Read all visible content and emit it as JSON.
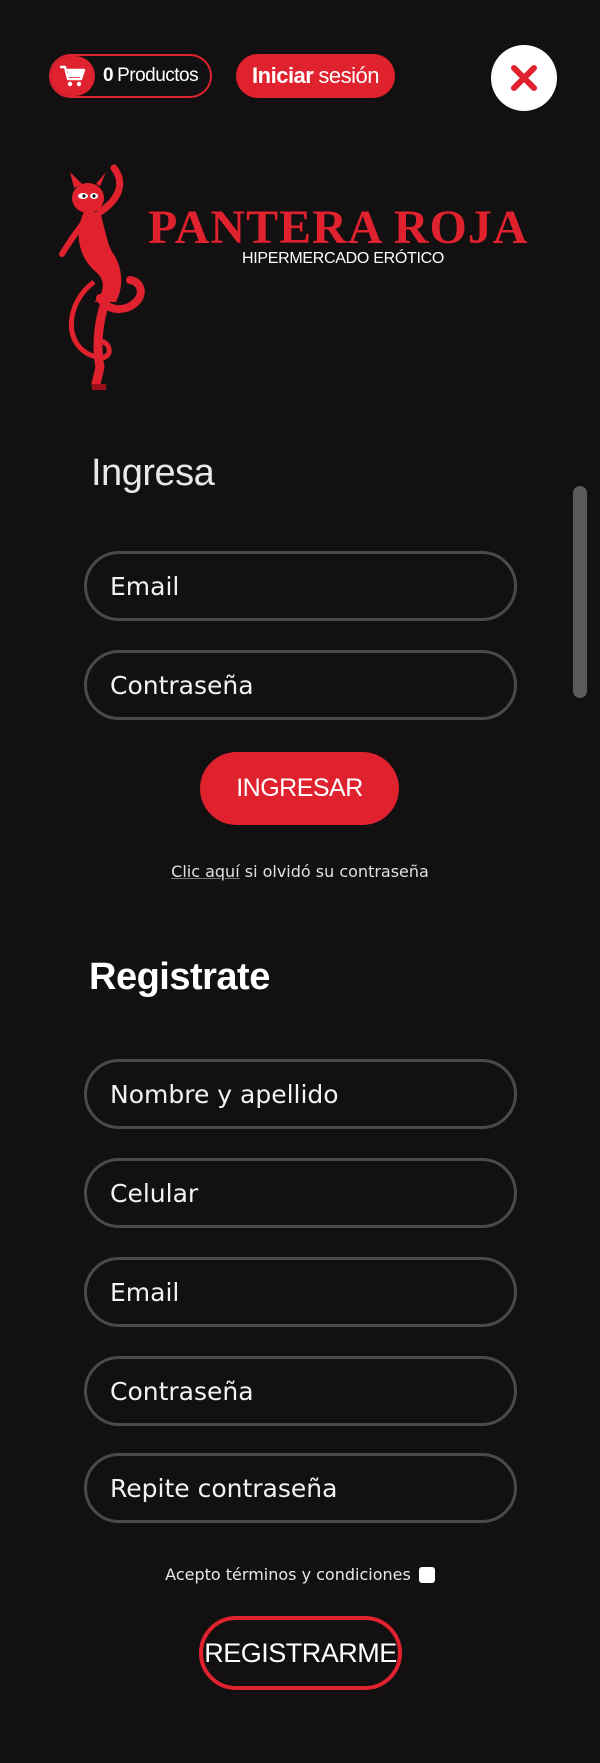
{
  "header": {
    "cart_count": "0",
    "cart_label": "Productos",
    "login_strong": "Iniciar",
    "login_rest": "sesión",
    "close_icon": "close-icon"
  },
  "brand": {
    "name": "PANTERA ROJA",
    "tagline": "HIPERMERCADO ERÓTICO",
    "mascot_icon": "panther-mascot-icon",
    "color": "#e0212e"
  },
  "login": {
    "title": "Ingresa",
    "email_placeholder": "Email",
    "password_placeholder": "Contraseña",
    "submit_label": "INGRESAR",
    "forgot_link": "Clic aquí",
    "forgot_rest": " si olvidó su contraseña"
  },
  "register": {
    "title": "Registrate",
    "name_placeholder": "Nombre y apellido",
    "phone_placeholder": "Celular",
    "email_placeholder": "Email",
    "password_placeholder": "Contraseña",
    "repeat_password_placeholder": "Repite contraseña",
    "terms_label": "Acepto términos y condiciones",
    "submit_label": "REGISTRARME"
  },
  "colors": {
    "accent": "#e0212e",
    "background": "#121011",
    "field_border": "#4a4a4a"
  }
}
